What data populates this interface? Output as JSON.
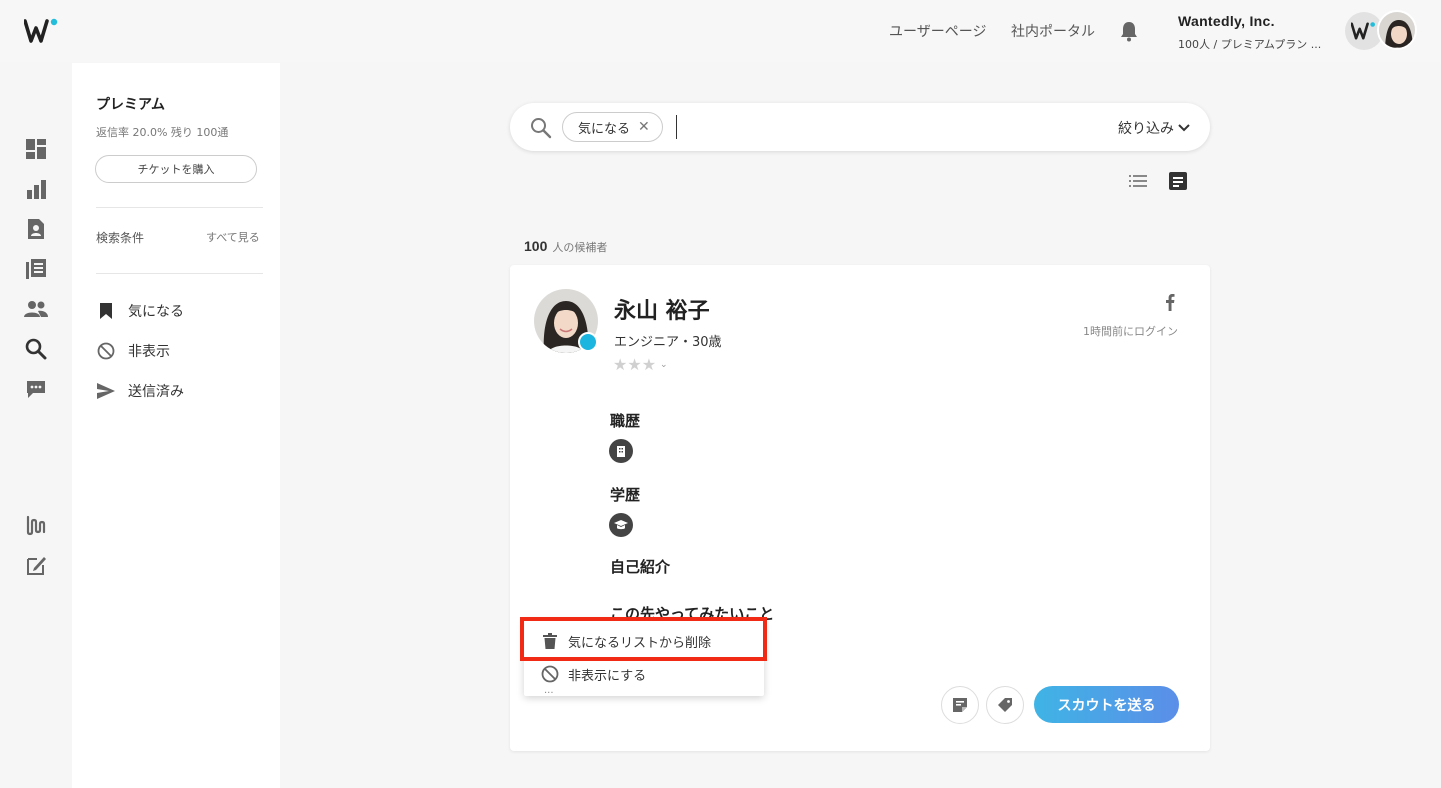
{
  "header": {
    "nav": [
      "ユーザーページ",
      "社内ポータル"
    ],
    "company_name": "Wantedly, Inc.",
    "company_sub": "100人 / プレミアムプラン ...",
    "icons": [
      "wantedly-logo-icon",
      "bell-icon"
    ]
  },
  "rail": {
    "top_icons": [
      "dashboard-icon",
      "bar-chart-icon",
      "profile-document-icon",
      "articles-icon",
      "people-icon",
      "search-icon",
      "chat-icon"
    ],
    "bottom_icons": [
      "wantedly-tools-icon",
      "edit-icon"
    ]
  },
  "left_panel": {
    "title": "プレミアム",
    "stats": "返信率 20.0%  残り 100通",
    "ticket_button": "チケットを購入",
    "conditions_label": "検索条件",
    "see_all": "すべて見る",
    "items": [
      {
        "label": "気になる",
        "icon": "bookmark-icon"
      },
      {
        "label": "非表示",
        "icon": "block-icon"
      },
      {
        "label": "送信済み",
        "icon": "send-icon"
      }
    ]
  },
  "search": {
    "chip_label": "気になる",
    "chip_remove": "✕",
    "value": "",
    "filter_label": "絞り込み"
  },
  "results": {
    "count": "100",
    "count_unit": "人の候補者"
  },
  "candidate": {
    "name": "永山 裕子",
    "subtitle": "エンジニア・30歳",
    "rating": 0,
    "max_rating": 3,
    "last_login": "1時間前にログイン",
    "sections": [
      {
        "title": "職歴",
        "icon": "building-icon"
      },
      {
        "title": "学歴",
        "icon": "graduation-cap-icon"
      },
      {
        "title": "自己紹介"
      },
      {
        "title": "この先やってみたいこと"
      }
    ],
    "scout_button": "スカウトを送る"
  },
  "context_menu": {
    "items": [
      {
        "label": "気になるリストから削除",
        "icon": "trash-icon"
      },
      {
        "label": "非表示にする",
        "icon": "block-icon"
      }
    ]
  },
  "colors": {
    "accent": "#21bddb",
    "highlight": "#f02a15",
    "scout_gradient_start": "#3fb4e5",
    "scout_gradient_end": "#5b8ee8"
  }
}
